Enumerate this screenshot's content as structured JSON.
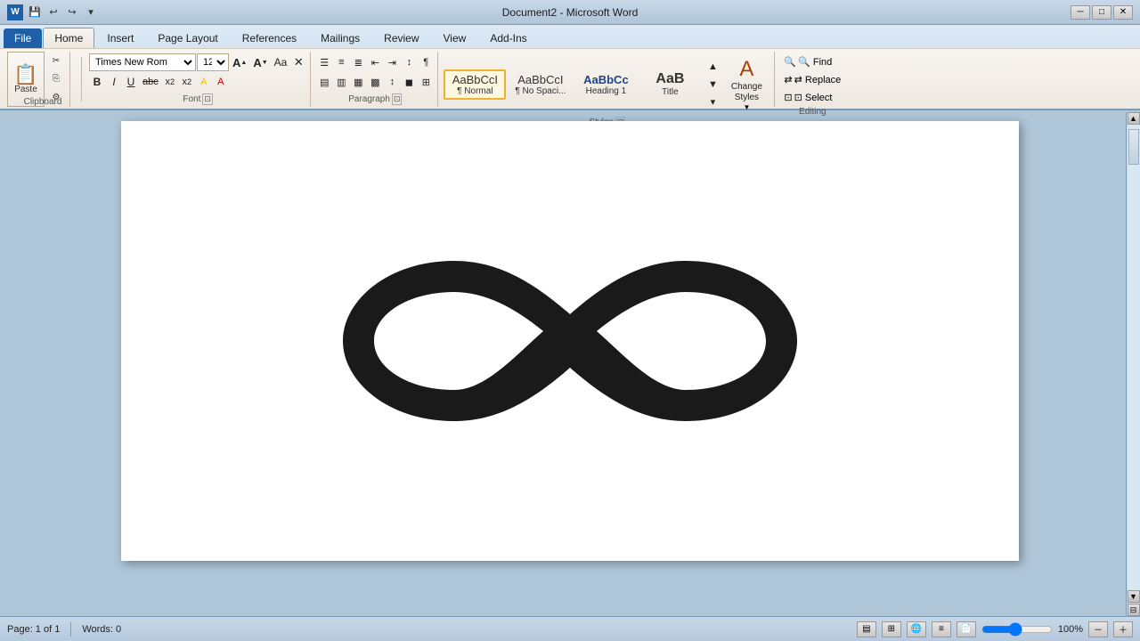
{
  "titlebar": {
    "title": "Document2 - Microsoft Word",
    "minimize": "─",
    "maximize": "□",
    "close": "✕"
  },
  "tabs": [
    {
      "label": "File",
      "id": "file",
      "active": false
    },
    {
      "label": "Home",
      "id": "home",
      "active": true
    },
    {
      "label": "Insert",
      "id": "insert",
      "active": false
    },
    {
      "label": "Page Layout",
      "id": "pagelayout",
      "active": false
    },
    {
      "label": "References",
      "id": "references",
      "active": false
    },
    {
      "label": "Mailings",
      "id": "mailings",
      "active": false
    },
    {
      "label": "Review",
      "id": "review",
      "active": false
    },
    {
      "label": "View",
      "id": "view",
      "active": false
    },
    {
      "label": "Add-Ins",
      "id": "addins",
      "active": false
    }
  ],
  "clipboard": {
    "label": "Clipboard",
    "paste_label": "Paste",
    "cut_label": "✂",
    "copy_label": "⎘",
    "format_label": "⚙"
  },
  "font": {
    "label": "Font",
    "name": "Times New Rom",
    "size": "12",
    "grow": "A↑",
    "shrink": "A↓",
    "change_case": "Aa",
    "clear": "⊘",
    "bold": "B",
    "italic": "I",
    "underline": "U",
    "strikethrough": "abc",
    "subscript": "x₂",
    "superscript": "x²",
    "highlight": "A",
    "color": "A"
  },
  "paragraph": {
    "label": "Paragraph",
    "bullets": "☰",
    "numbering": "≡",
    "multilevel": "≣",
    "decrease": "←",
    "increase": "→",
    "sort": "↕",
    "marks": "¶",
    "align_left": "◧",
    "align_center": "◫",
    "align_right": "◨",
    "justify": "▦",
    "line_spacing": "↕",
    "shading": "◼",
    "borders": "⊞"
  },
  "styles": {
    "label": "Styles",
    "items": [
      {
        "label": "AaBbCcI",
        "sublabel": "¶ Normal",
        "active": true
      },
      {
        "label": "AaBbCcI",
        "sublabel": "¶ No Spaci...",
        "active": false
      },
      {
        "label": "AaBbCc",
        "sublabel": "Heading 1",
        "active": false
      },
      {
        "label": "AaB",
        "sublabel": "Title",
        "active": false
      }
    ],
    "change_styles_label": "Change\nStyles"
  },
  "editing": {
    "label": "Editing",
    "find": "🔍 Find",
    "replace": "⇄ Replace",
    "select": "⊡ Select"
  },
  "document": {
    "page_info": "Page: 1 of 1",
    "words": "Words: 0"
  },
  "statusbar": {
    "page": "Page: 1 of 1",
    "words": "Words: 0",
    "zoom": "100%"
  }
}
